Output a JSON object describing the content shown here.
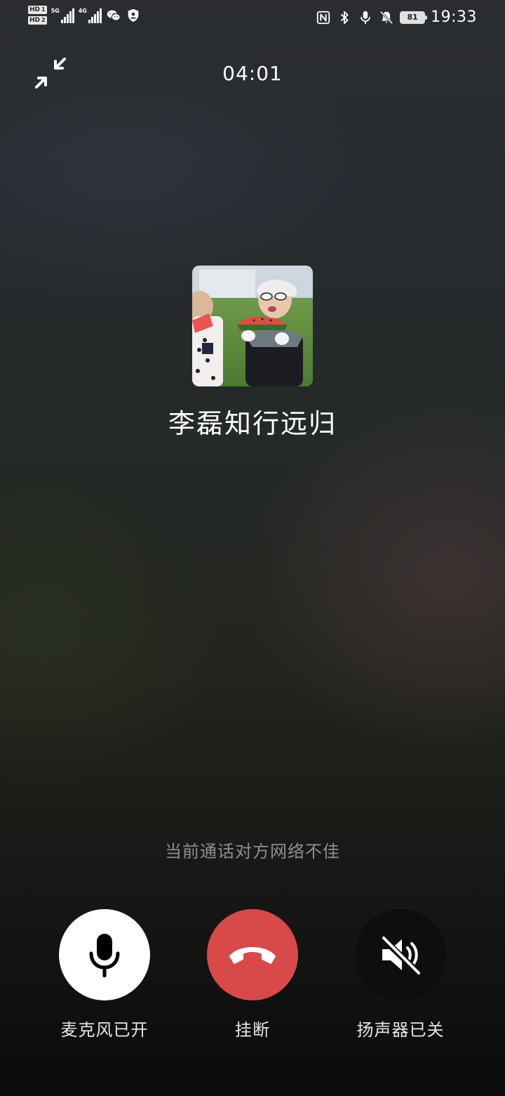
{
  "status_bar": {
    "sim1_label": "HD",
    "sim1_num": "1",
    "sim2_label": "HD",
    "sim2_num": "2",
    "net1_type": "5G",
    "net2_type": "4G",
    "battery_level": "81",
    "time": "19:33",
    "icons": [
      "wechat-icon",
      "shield-icon",
      "nfc-icon",
      "bluetooth-icon",
      "microphone-icon",
      "bell-muted-icon",
      "battery-icon"
    ]
  },
  "call": {
    "timer": "04:01",
    "contact_name": "李磊知行远归",
    "network_warning": "当前通话对方网络不佳"
  },
  "controls": {
    "mic_label": "麦克风已开",
    "hangup_label": "挂断",
    "speaker_label": "扬声器已关"
  },
  "colors": {
    "hangup": "#d84a4a",
    "mic_active": "#ffffff",
    "speaker_off": "#0e0e0e",
    "warning_text": "#8f8f8f"
  }
}
